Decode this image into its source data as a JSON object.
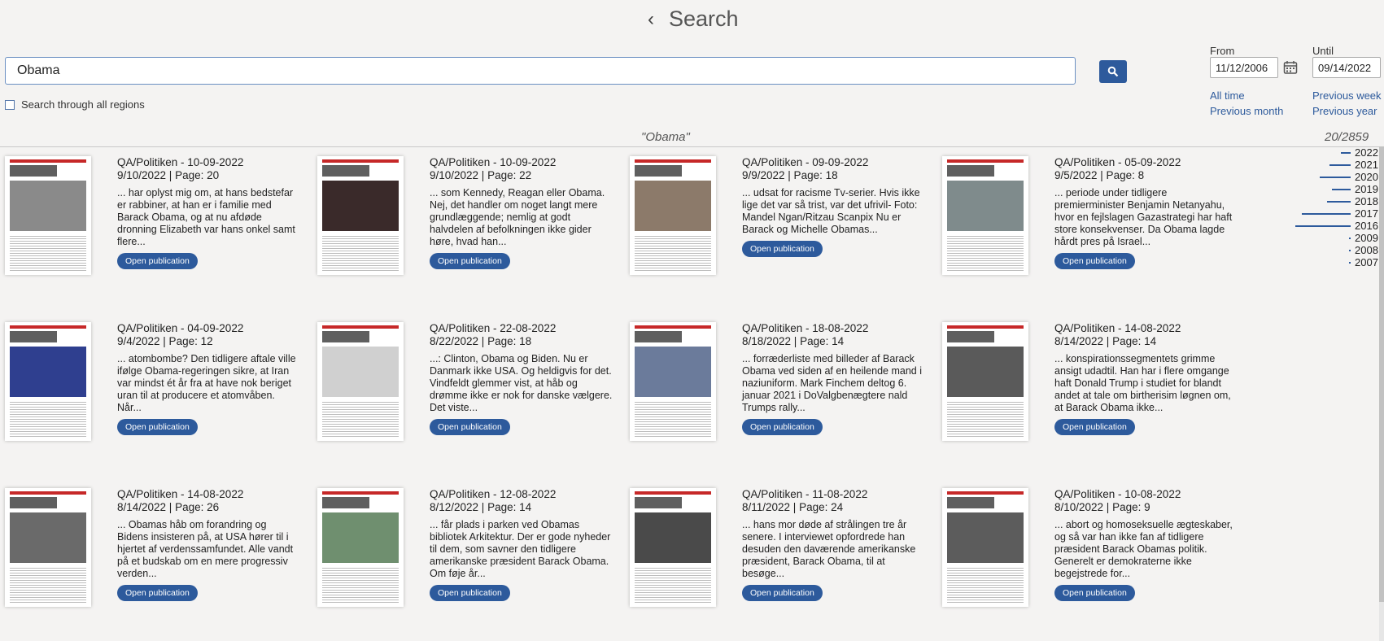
{
  "header": {
    "back_icon": "chevron-left-icon",
    "title": "Search"
  },
  "search": {
    "value": "Obama",
    "button_icon": "search-icon"
  },
  "regions": {
    "label": "Search through all regions",
    "checked": false
  },
  "dates": {
    "from_label": "From",
    "from_value": "11/12/2006",
    "until_label": "Until",
    "until_value": "09/14/2022",
    "calendar_icon": "calendar-icon",
    "quick": {
      "all_time": "All time",
      "previous_week": "Previous week",
      "previous_month": "Previous month",
      "previous_year": "Previous year"
    }
  },
  "results": {
    "query": "\"Obama\"",
    "count": "20/2859",
    "open_label": "Open publication",
    "items": [
      {
        "source": "QA/Politiken - 10-09-2022",
        "date_page": "9/10/2022 | Page: 20",
        "snippet": "... har oplyst mig om, at hans bedstefar er rabbiner, at han er i familie med Barack Obama, og at nu afdøde dronning Elizabeth var hans onkel samt flere..."
      },
      {
        "source": "QA/Politiken - 10-09-2022",
        "date_page": "9/10/2022 | Page: 22",
        "snippet": "... som Kennedy, Reagan eller Obama. Nej, det handler om noget langt mere grundlæggende; nemlig at godt halvdelen af befolkningen ikke gider høre, hvad han..."
      },
      {
        "source": "QA/Politiken - 09-09-2022",
        "date_page": "9/9/2022 | Page: 18",
        "snippet": "... udsat for racisme Tv-serier. Hvis ikke lige det var så trist, var det ufrivil- Foto: Mandel Ngan/Ritzau Scanpix Nu er Barack og Michelle Obamas..."
      },
      {
        "source": "QA/Politiken - 05-09-2022",
        "date_page": "9/5/2022 | Page: 8",
        "snippet": "... periode under tidligere premierminister Benjamin Netanyahu, hvor en fejlslagen Gazastrategi har haft store konsekvenser. Da Obama lagde hårdt pres på Israel..."
      },
      {
        "source": "QA/Politiken - 04-09-2022",
        "date_page": "9/4/2022 | Page: 12",
        "snippet": "... atombombe? Den tidligere aftale ville ifølge Obama-regeringen sikre, at Iran var mindst ét år fra at have nok beriget uran til at producere et atomvåben. Når..."
      },
      {
        "source": "QA/Politiken - 22-08-2022",
        "date_page": "8/22/2022 | Page: 18",
        "snippet": "...: Clinton, Obama og Biden. Nu er Danmark ikke USA. Og heldigvis for det. Vindfeldt glemmer vist, at håb og drømme ikke er nok for danske vælgere. Det viste..."
      },
      {
        "source": "QA/Politiken - 18-08-2022",
        "date_page": "8/18/2022 | Page: 14",
        "snippet": "... forræderliste med billeder af Barack Obama ved siden af en heilende mand i naziuniform. Mark Finchem deltog 6. januar 2021 i DoValgbenægtere nald Trumps rally..."
      },
      {
        "source": "QA/Politiken - 14-08-2022",
        "date_page": "8/14/2022 | Page: 14",
        "snippet": "... konspirationssegmentets grimme ansigt udadtil. Han har i flere omgange haft Donald Trump i studiet for blandt andet at tale om birtherisim løgnen om, at Barack Obama ikke..."
      },
      {
        "source": "QA/Politiken - 14-08-2022",
        "date_page": "8/14/2022 | Page: 26",
        "snippet": "... Obamas håb om forandring og Bidens insisteren på, at USA hører til i hjertet af verdenssamfundet. Alle vandt på et budskab om en mere progressiv verden..."
      },
      {
        "source": "QA/Politiken - 12-08-2022",
        "date_page": "8/12/2022 | Page: 14",
        "snippet": "... får plads i parken ved Obamas bibliotek Arkitektur. Der er gode nyheder til dem, som savner den tidligere amerikanske præsident Barack Obama. Om føje år..."
      },
      {
        "source": "QA/Politiken - 11-08-2022",
        "date_page": "8/11/2022 | Page: 24",
        "snippet": "... hans mor døde af strålingen tre år senere. I interviewet opfordrede han desuden den daværende amerikanske præsident, Barack Obama, til at besøge..."
      },
      {
        "source": "QA/Politiken - 10-08-2022",
        "date_page": "8/10/2022 | Page: 9",
        "snippet": "... abort og homoseksuelle ægteskaber, og så var han ikke fan af tidligere præsident Barack Obamas politik. Generelt er demokraterne ikke begejstrede for..."
      }
    ]
  },
  "timeline": [
    {
      "year": "2022",
      "fraction": 0.18
    },
    {
      "year": "2021",
      "fraction": 0.38
    },
    {
      "year": "2020",
      "fraction": 0.56
    },
    {
      "year": "2019",
      "fraction": 0.34
    },
    {
      "year": "2018",
      "fraction": 0.42
    },
    {
      "year": "2017",
      "fraction": 0.88
    },
    {
      "year": "2016",
      "fraction": 1.0
    },
    {
      "year": "2009",
      "fraction": 0.02
    },
    {
      "year": "2008",
      "fraction": 0.02
    },
    {
      "year": "2007",
      "fraction": 0.02
    }
  ]
}
